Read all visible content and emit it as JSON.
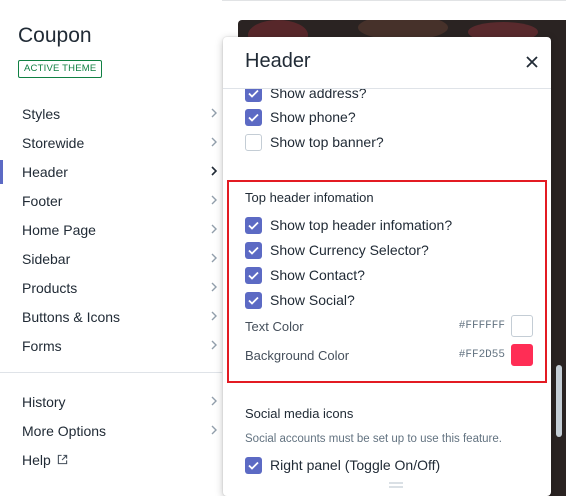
{
  "sidebar": {
    "theme_name": "Coupon",
    "badge": "ACTIVE THEME",
    "items": [
      {
        "label": "Styles"
      },
      {
        "label": "Storewide"
      },
      {
        "label": "Header"
      },
      {
        "label": "Footer"
      },
      {
        "label": "Home Page"
      },
      {
        "label": "Sidebar"
      },
      {
        "label": "Products"
      },
      {
        "label": "Buttons & Icons"
      },
      {
        "label": "Forms"
      }
    ],
    "active_item": "Header",
    "bottom_items": [
      {
        "label": "History"
      },
      {
        "label": "More Options"
      },
      {
        "label": "Help"
      }
    ]
  },
  "panel": {
    "title": "Header",
    "close_icon": "close-icon",
    "checkboxes_top": [
      {
        "label": "Show address?",
        "checked": true
      },
      {
        "label": "Show phone?",
        "checked": true
      },
      {
        "label": "Show top banner?",
        "checked": false
      }
    ],
    "top_header": {
      "title": "Top header infomation",
      "checkboxes": [
        {
          "label": "Show top header infomation?",
          "checked": true
        },
        {
          "label": "Show Currency Selector?",
          "checked": true
        },
        {
          "label": "Show Contact?",
          "checked": true
        },
        {
          "label": "Show Social?",
          "checked": true
        }
      ],
      "text_color": {
        "label": "Text Color",
        "hex": "#FFFFFF",
        "value": "#FFFFFF"
      },
      "background_color": {
        "label": "Background Color",
        "hex": "#FF2D55",
        "value": "#FF2D55"
      }
    },
    "social": {
      "title": "Social media icons",
      "help": "Social accounts must be set up to use this feature.",
      "checkboxes": [
        {
          "label": "Right panel (Toggle On/Off)",
          "checked": true
        }
      ]
    }
  },
  "colors": {
    "accent": "#5C6AC4",
    "highlight": "#E31B23",
    "badge": "#108043"
  }
}
